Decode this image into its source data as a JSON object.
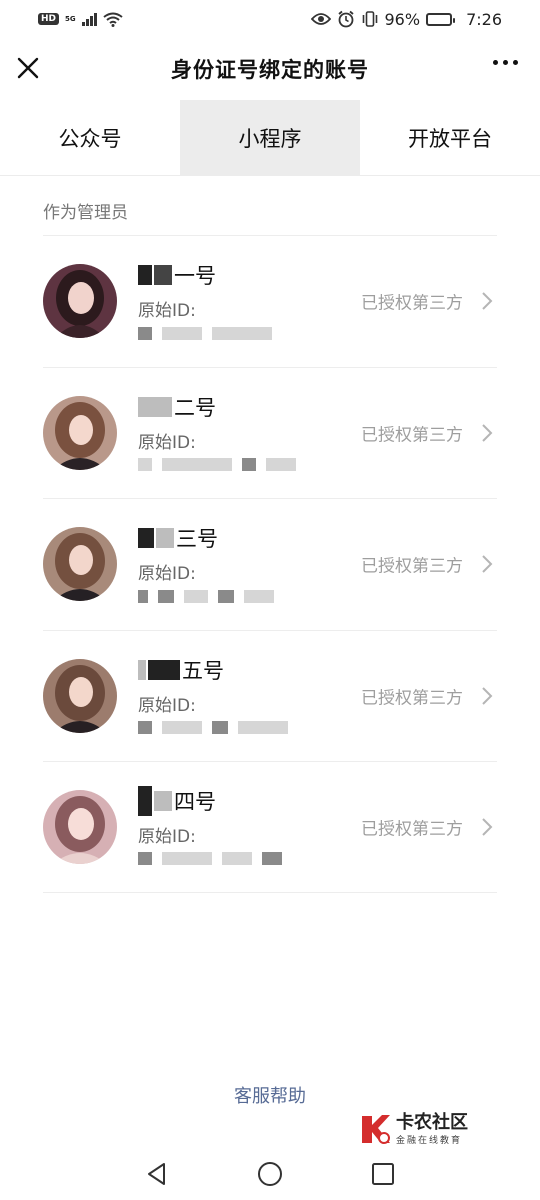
{
  "status_bar": {
    "hd": "HD",
    "network": "5G",
    "battery_percent": "96%",
    "time": "7:26",
    "battery_level": 0.96
  },
  "header": {
    "title": "身份证号绑定的账号",
    "close_icon": "close-icon",
    "more_icon": "more-icon"
  },
  "tabs": [
    {
      "label": "公众号",
      "active": false
    },
    {
      "label": "小程序",
      "active": true
    },
    {
      "label": "开放平台",
      "active": false
    }
  ],
  "section_label": "作为管理员",
  "accounts": [
    {
      "name_suffix": "一号",
      "id_label": "原始ID:",
      "status": "已授权第三方",
      "avatar_bg": "#6b3a49"
    },
    {
      "name_suffix": "二号",
      "id_label": "原始ID:",
      "status": "已授权第三方",
      "avatar_bg": "#a98473"
    },
    {
      "name_suffix": "三号",
      "id_label": "原始ID:",
      "status": "已授权第三方",
      "avatar_bg": "#9c7b69"
    },
    {
      "name_suffix": "五号",
      "id_label": "原始ID:",
      "status": "已授权第三方",
      "avatar_bg": "#8f6c5f"
    },
    {
      "name_suffix": "四号",
      "id_label": "原始ID:",
      "status": "已授权第三方",
      "avatar_bg": "#c99aa0"
    }
  ],
  "help_link": "客服帮助",
  "watermark": {
    "main": "卡农社区",
    "sub": "金融在线教育"
  },
  "nav_bar": {
    "back_icon": "back-triangle-icon",
    "home_icon": "home-circle-icon",
    "recents_icon": "recents-square-icon"
  }
}
